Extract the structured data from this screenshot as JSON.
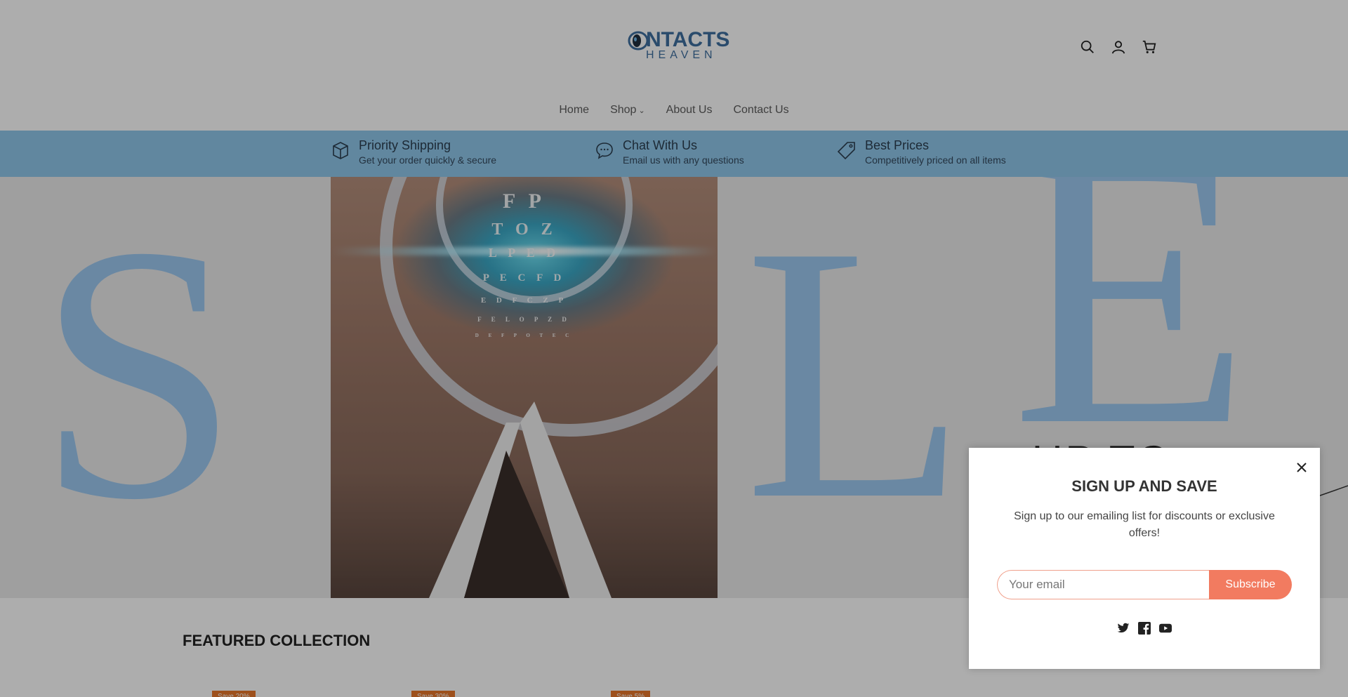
{
  "brand": {
    "logo_main": "NTACTS",
    "logo_sub": "HEAVEN",
    "logo_color": "#3f6f9f"
  },
  "header_icons": [
    {
      "name": "search-icon"
    },
    {
      "name": "account-icon"
    },
    {
      "name": "cart-icon"
    }
  ],
  "nav": {
    "items": [
      "Home",
      "Shop",
      "About Us",
      "Contact Us"
    ]
  },
  "features": [
    {
      "icon": "box-icon",
      "title": "Priority Shipping",
      "subtitle": "Get your order quickly & secure"
    },
    {
      "icon": "chat-icon",
      "title": "Chat With Us",
      "subtitle": "Email us with any questions"
    },
    {
      "icon": "price-tag-icon",
      "title": "Best Prices",
      "subtitle": "Competitively priced on all items"
    }
  ],
  "hero": {
    "letters": [
      "S",
      "A",
      "L",
      "E"
    ],
    "eye_chart_lines": [
      "F P",
      "T O Z",
      "L P E D",
      "P E C F D",
      "E D F C Z P",
      "F E L O P Z D",
      "D E F P O T E C"
    ],
    "upto_text": "UP TO",
    "accent_color": "#9cc9f1"
  },
  "featured": {
    "title": "FEATURED COLLECTION",
    "badges": [
      "Save 20%",
      "Save 30%",
      "Save 5%"
    ]
  },
  "popup": {
    "title": "SIGN UP AND SAVE",
    "text": "Sign up to our emailing list for discounts or exclusive offers!",
    "email_placeholder": "Your email",
    "subscribe_label": "Subscribe",
    "button_color": "#f27b60",
    "social": [
      "twitter-icon",
      "facebook-icon",
      "youtube-icon"
    ]
  },
  "colors": {
    "features_bar": "#8fc8ea",
    "overlay": "rgba(0,0,0,0.32)"
  }
}
